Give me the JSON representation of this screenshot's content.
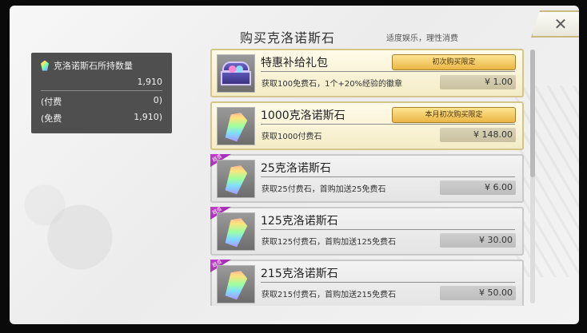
{
  "header": {
    "title": "购买克洛诺斯石",
    "subtitle": "适度娱乐，理性消费"
  },
  "balance": {
    "label": "克洛诺斯石所持数量",
    "total": "1,910",
    "paid_label": "(付费",
    "paid_value": "0)",
    "free_label": "(免费",
    "free_value": "1,910)"
  },
  "close_icon_glyph": "✕",
  "items": [
    {
      "name": "特惠补给礼包",
      "desc": "获取100免费石，1个+20%经验的徽章",
      "price": "¥ 1.00",
      "limit": "初次购买限定",
      "icon": "treasure-chest-icon",
      "style": "gold"
    },
    {
      "name": "1000克洛诺斯石",
      "desc": "获取1000付费石",
      "price": "¥ 148.00",
      "limit": "本月初次购买限定",
      "icon": "crystal-icon",
      "style": "gold"
    },
    {
      "name": "25克洛诺斯石",
      "desc": "获取25付费石，首购加送25免费石",
      "price": "¥ 6.00",
      "badge": "超值",
      "icon": "crystal-icon",
      "style": "silver"
    },
    {
      "name": "125克洛诺斯石",
      "desc": "获取125付费石，首购加送125免费石",
      "price": "¥ 30.00",
      "badge": "超值",
      "icon": "crystal-icon",
      "style": "silver"
    },
    {
      "name": "215克洛诺斯石",
      "desc": "获取215付费石，首购加送215免费石",
      "price": "¥ 50.00",
      "badge": "超值",
      "icon": "crystal-icon",
      "style": "silver"
    }
  ],
  "colors": {
    "gold_border": "#d6c58a",
    "silver_border": "#c9c9c9",
    "limit_button": "#e9b645",
    "badge": "#c43fd1",
    "balance_panel": "#4f4f4f"
  }
}
